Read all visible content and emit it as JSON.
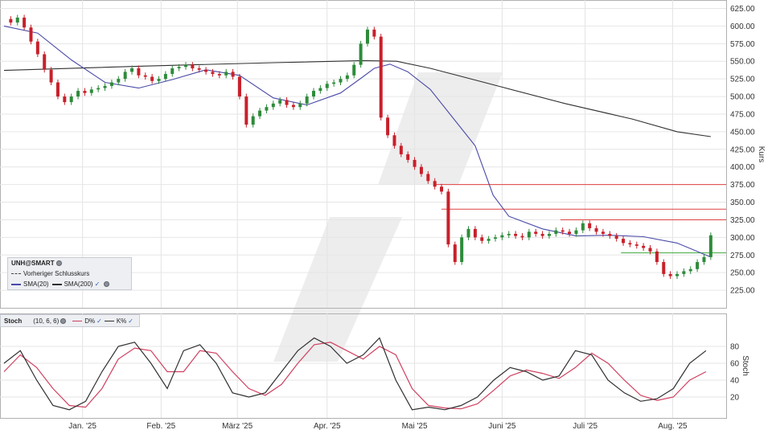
{
  "legend": {
    "symbol": "UNH@SMART",
    "prev_close": "Vorheriger Schlusskurs",
    "sma20": "SMA(20)",
    "sma200": "SMA(200)"
  },
  "stoch_legend": {
    "title": "Stoch",
    "params": "(10, 6, 6)",
    "d_label": "D%",
    "k_label": "K%"
  },
  "colors": {
    "up": "#2e8b3a",
    "down": "#c8202a",
    "sma20": "#4a4aa8",
    "sma200": "#303030",
    "stoch_d": "#d04060",
    "stoch_k": "#303030",
    "levels": "#e04040",
    "support": "#3aaa3a"
  },
  "chart_data": [
    {
      "type": "candlestick",
      "ylabel": "Kurs",
      "ylim": [
        200,
        637
      ],
      "y_ticks": [
        "225.00",
        "250.00",
        "275.00",
        "300.00",
        "325.00",
        "350.00",
        "375.00",
        "400.00",
        "425.00",
        "450.00",
        "475.00",
        "500.00",
        "525.00",
        "550.00",
        "575.00",
        "600.00",
        "625.00"
      ],
      "x_ticks": [
        "Jan. '25",
        "Feb. '25",
        "März '25",
        "Apr. '25",
        "Mai '25",
        "Juni '25",
        "Juli '25",
        "Aug. '25"
      ],
      "close_series": [
        [
          0,
          610
        ],
        [
          3,
          605
        ],
        [
          6,
          612
        ],
        [
          9,
          598
        ],
        [
          12,
          578
        ],
        [
          15,
          560
        ],
        [
          18,
          538
        ],
        [
          21,
          520
        ],
        [
          24,
          500
        ],
        [
          27,
          492
        ],
        [
          30,
          500
        ],
        [
          33,
          508
        ],
        [
          36,
          505
        ],
        [
          39,
          510
        ],
        [
          42,
          512
        ],
        [
          45,
          515
        ],
        [
          48,
          520
        ],
        [
          51,
          525
        ],
        [
          54,
          535
        ],
        [
          57,
          540
        ],
        [
          60,
          530
        ],
        [
          63,
          528
        ],
        [
          66,
          522
        ],
        [
          69,
          525
        ],
        [
          72,
          532
        ],
        [
          75,
          540
        ],
        [
          78,
          542
        ],
        [
          81,
          545
        ],
        [
          84,
          540
        ],
        [
          87,
          538
        ],
        [
          90,
          535
        ],
        [
          93,
          532
        ],
        [
          96,
          530
        ],
        [
          99,
          535
        ],
        [
          102,
          528
        ],
        [
          105,
          500
        ],
        [
          108,
          460
        ],
        [
          111,
          472
        ],
        [
          114,
          480
        ],
        [
          117,
          485
        ],
        [
          120,
          490
        ],
        [
          123,
          495
        ],
        [
          126,
          488
        ],
        [
          129,
          485
        ],
        [
          132,
          490
        ],
        [
          135,
          500
        ],
        [
          138,
          508
        ],
        [
          141,
          512
        ],
        [
          144,
          518
        ],
        [
          147,
          520
        ],
        [
          150,
          525
        ],
        [
          153,
          530
        ],
        [
          156,
          545
        ],
        [
          159,
          575
        ],
        [
          162,
          595
        ],
        [
          165,
          585
        ],
        [
          168,
          470
        ],
        [
          171,
          445
        ],
        [
          174,
          430
        ],
        [
          177,
          418
        ],
        [
          180,
          410
        ],
        [
          183,
          400
        ],
        [
          186,
          390
        ],
        [
          189,
          380
        ],
        [
          192,
          372
        ],
        [
          195,
          365
        ],
        [
          198,
          290
        ],
        [
          201,
          265
        ],
        [
          204,
          300
        ],
        [
          207,
          312
        ],
        [
          210,
          300
        ],
        [
          213,
          295
        ],
        [
          216,
          298
        ],
        [
          219,
          300
        ],
        [
          222,
          303
        ],
        [
          225,
          305
        ],
        [
          228,
          302
        ],
        [
          231,
          300
        ],
        [
          234,
          308
        ],
        [
          237,
          305
        ],
        [
          240,
          302
        ],
        [
          243,
          305
        ],
        [
          246,
          310
        ],
        [
          249,
          308
        ],
        [
          252,
          305
        ],
        [
          255,
          310
        ],
        [
          258,
          320
        ],
        [
          261,
          313
        ],
        [
          264,
          308
        ],
        [
          267,
          305
        ],
        [
          270,
          302
        ],
        [
          273,
          298
        ],
        [
          276,
          292
        ],
        [
          279,
          290
        ],
        [
          282,
          288
        ],
        [
          285,
          285
        ],
        [
          288,
          280
        ],
        [
          291,
          265
        ],
        [
          294,
          248
        ],
        [
          297,
          245
        ],
        [
          300,
          248
        ],
        [
          303,
          252
        ],
        [
          306,
          255
        ],
        [
          309,
          265
        ],
        [
          312,
          272
        ],
        [
          315,
          303
        ]
      ],
      "sma20": [
        [
          0,
          600
        ],
        [
          15,
          590
        ],
        [
          30,
          552
        ],
        [
          45,
          520
        ],
        [
          60,
          512
        ],
        [
          75,
          524
        ],
        [
          90,
          538
        ],
        [
          105,
          530
        ],
        [
          120,
          498
        ],
        [
          135,
          488
        ],
        [
          150,
          505
        ],
        [
          160,
          528
        ],
        [
          165,
          540
        ],
        [
          172,
          546
        ],
        [
          180,
          535
        ],
        [
          190,
          510
        ],
        [
          200,
          470
        ],
        [
          210,
          430
        ],
        [
          218,
          360
        ],
        [
          225,
          330
        ],
        [
          240,
          312
        ],
        [
          255,
          302
        ],
        [
          270,
          303
        ],
        [
          285,
          301
        ],
        [
          300,
          292
        ],
        [
          315,
          272
        ]
      ],
      "sma200": [
        [
          0,
          537
        ],
        [
          60,
          543
        ],
        [
          120,
          548
        ],
        [
          160,
          551
        ],
        [
          175,
          550
        ],
        [
          190,
          540
        ],
        [
          220,
          515
        ],
        [
          250,
          490
        ],
        [
          280,
          468
        ],
        [
          300,
          450
        ],
        [
          315,
          443
        ]
      ],
      "levels": [
        {
          "price": 375,
          "from": 192
        },
        {
          "price": 340,
          "from": 195
        },
        {
          "price": 325,
          "from": 248
        }
      ],
      "support": [
        {
          "price": 278,
          "from": 275
        }
      ]
    },
    {
      "type": "line",
      "title": "Stoch",
      "ylabel": "Stoch",
      "ylim": [
        0,
        100
      ],
      "y_ticks": [
        "20",
        "40",
        "60",
        "80"
      ],
      "series": [
        {
          "name": "K%",
          "points": [
            [
              0,
              60
            ],
            [
              5,
              75
            ],
            [
              10,
              40
            ],
            [
              15,
              10
            ],
            [
              20,
              5
            ],
            [
              25,
              15
            ],
            [
              30,
              50
            ],
            [
              35,
              80
            ],
            [
              40,
              85
            ],
            [
              45,
              60
            ],
            [
              50,
              30
            ],
            [
              55,
              75
            ],
            [
              60,
              82
            ],
            [
              65,
              60
            ],
            [
              70,
              25
            ],
            [
              75,
              20
            ],
            [
              80,
              25
            ],
            [
              85,
              50
            ],
            [
              90,
              75
            ],
            [
              95,
              90
            ],
            [
              100,
              80
            ],
            [
              105,
              60
            ],
            [
              110,
              70
            ],
            [
              115,
              90
            ],
            [
              120,
              40
            ],
            [
              125,
              5
            ],
            [
              130,
              8
            ],
            [
              135,
              5
            ],
            [
              140,
              10
            ],
            [
              145,
              20
            ],
            [
              150,
              40
            ],
            [
              155,
              55
            ],
            [
              160,
              50
            ],
            [
              165,
              40
            ],
            [
              170,
              45
            ],
            [
              175,
              75
            ],
            [
              180,
              70
            ],
            [
              185,
              40
            ],
            [
              190,
              25
            ],
            [
              195,
              15
            ],
            [
              200,
              18
            ],
            [
              205,
              30
            ],
            [
              210,
              60
            ],
            [
              215,
              75
            ]
          ]
        },
        {
          "name": "D%",
          "points": [
            [
              0,
              50
            ],
            [
              5,
              70
            ],
            [
              10,
              55
            ],
            [
              15,
              30
            ],
            [
              20,
              10
            ],
            [
              25,
              8
            ],
            [
              30,
              30
            ],
            [
              35,
              65
            ],
            [
              40,
              78
            ],
            [
              45,
              75
            ],
            [
              50,
              50
            ],
            [
              55,
              50
            ],
            [
              60,
              75
            ],
            [
              65,
              72
            ],
            [
              70,
              50
            ],
            [
              75,
              30
            ],
            [
              80,
              22
            ],
            [
              85,
              35
            ],
            [
              90,
              60
            ],
            [
              95,
              82
            ],
            [
              100,
              85
            ],
            [
              105,
              75
            ],
            [
              110,
              65
            ],
            [
              115,
              80
            ],
            [
              120,
              70
            ],
            [
              125,
              30
            ],
            [
              130,
              10
            ],
            [
              135,
              7
            ],
            [
              140,
              6
            ],
            [
              145,
              12
            ],
            [
              150,
              28
            ],
            [
              155,
              45
            ],
            [
              160,
              52
            ],
            [
              165,
              48
            ],
            [
              170,
              42
            ],
            [
              175,
              55
            ],
            [
              180,
              72
            ],
            [
              185,
              60
            ],
            [
              190,
              40
            ],
            [
              195,
              22
            ],
            [
              200,
              16
            ],
            [
              205,
              20
            ],
            [
              210,
              40
            ],
            [
              215,
              50
            ]
          ]
        }
      ]
    }
  ]
}
